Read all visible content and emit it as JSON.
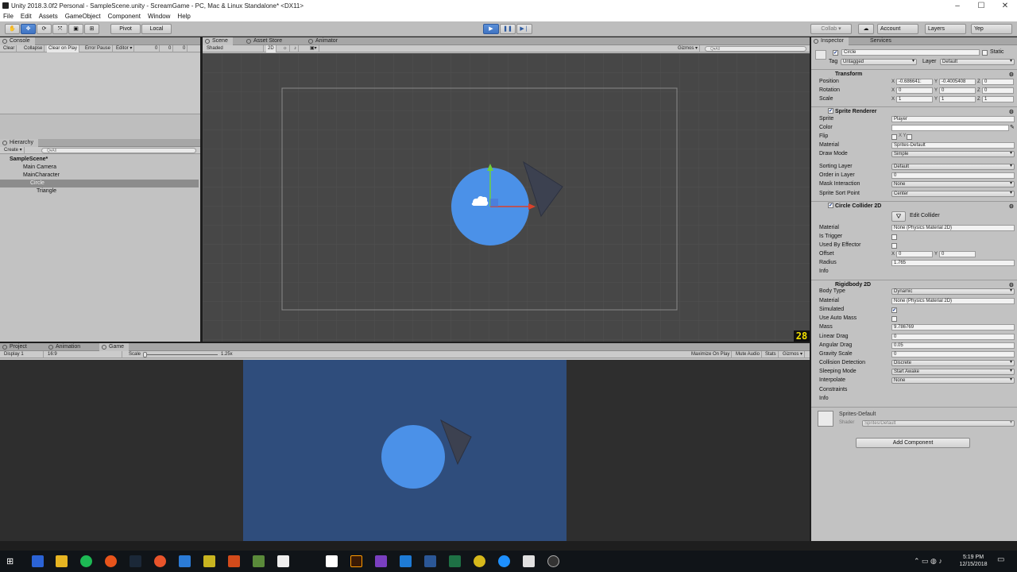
{
  "window": {
    "title": "Unity 2018.3.0f2 Personal - SampleScene.unity - ScreamGame - PC, Mac & Linux Standalone* <DX11>"
  },
  "menu": [
    "File",
    "Edit",
    "Assets",
    "GameObject",
    "Component",
    "Window",
    "Help"
  ],
  "toolbar": {
    "pivot": "Pivot",
    "local": "Local",
    "collab": "Collab ▾",
    "account": "Account",
    "layers": "Layers",
    "layout": "Yep"
  },
  "console": {
    "tab": "Console",
    "buttons": [
      "Clear",
      "Collapse",
      "Clear on Play",
      "Error Pause",
      "Editor ▾"
    ],
    "counts": [
      "0",
      "0",
      "0"
    ]
  },
  "hierarchy": {
    "tab": "Hierarchy",
    "create": "Create ▾",
    "search_placeholder": "Q▾All",
    "items": [
      {
        "label": "SampleScene*",
        "indent": 0
      },
      {
        "label": "Main Camera",
        "indent": 1
      },
      {
        "label": "MainCharacter",
        "indent": 1
      },
      {
        "label": "Circle",
        "indent": 2
      },
      {
        "label": "Triangle",
        "indent": 3
      }
    ]
  },
  "scene": {
    "tabs": [
      "Scene",
      "Asset Store",
      "Animator"
    ],
    "shading": "Shaded",
    "mode": "2D",
    "gizmos": "Gizmos ▾",
    "search_placeholder": "Q▾All",
    "fps": "28"
  },
  "game": {
    "tabs": [
      "Project",
      "Animation",
      "Game"
    ],
    "display": "Display 1",
    "aspect": "16:9",
    "scale_label": "Scale",
    "scale_value": "1.25x",
    "buttons": [
      "Maximize On Play",
      "Mute Audio",
      "Stats",
      "Gizmos ▾"
    ]
  },
  "inspector": {
    "tabs": [
      "Inspector",
      "Services"
    ],
    "object_name": "Circle",
    "static": "Static",
    "tag_label": "Tag",
    "tag": "Untagged",
    "layer_label": "Layer",
    "layer": "Default",
    "transform": {
      "title": "Transform",
      "position": {
        "label": "Position",
        "x": "-0.686641:",
        "y": "-0.4005408",
        "z": "0"
      },
      "rotation": {
        "label": "Rotation",
        "x": "0",
        "y": "0",
        "z": "0"
      },
      "scale": {
        "label": "Scale",
        "x": "1",
        "y": "1",
        "z": "1"
      }
    },
    "sprite_renderer": {
      "title": "Sprite Renderer",
      "rows": [
        {
          "label": "Sprite",
          "value": "Player",
          "kind": "field"
        },
        {
          "label": "Color",
          "value": "",
          "kind": "color"
        },
        {
          "label": "Flip",
          "value": "X  Y",
          "kind": "flip"
        },
        {
          "label": "Material",
          "value": "Sprites-Default",
          "kind": "field"
        },
        {
          "label": "Draw Mode",
          "value": "Simple",
          "kind": "dropdown"
        },
        {
          "label": "Sorting Layer",
          "value": "Default",
          "kind": "dropdown"
        },
        {
          "label": "Order in Layer",
          "value": "0",
          "kind": "field"
        },
        {
          "label": "Mask Interaction",
          "value": "None",
          "kind": "dropdown"
        },
        {
          "label": "Sprite Sort Point",
          "value": "Center",
          "kind": "dropdown"
        }
      ]
    },
    "circle_collider": {
      "title": "Circle Collider 2D",
      "edit": "Edit Collider",
      "material": {
        "label": "Material",
        "value": "None (Physics Material 2D)"
      },
      "is_trigger": "Is Trigger",
      "used_by_effector": "Used By Effector",
      "offset": {
        "label": "Offset",
        "x": "0",
        "y": "0"
      },
      "radius": {
        "label": "Radius",
        "value": "1.765"
      },
      "info": "Info"
    },
    "rigidbody": {
      "title": "Rigidbody 2D",
      "body_type": {
        "label": "Body Type",
        "value": "Dynamic"
      },
      "material": {
        "label": "Material",
        "value": "None (Physics Material 2D)"
      },
      "simulated": "Simulated",
      "use_auto_mass": "Use Auto Mass",
      "mass": {
        "label": "Mass",
        "value": "9.786769"
      },
      "linear_drag": {
        "label": "Linear Drag",
        "value": "0"
      },
      "angular_drag": {
        "label": "Angular Drag",
        "value": "0.05"
      },
      "gravity_scale": {
        "label": "Gravity Scale",
        "value": "0"
      },
      "collision": {
        "label": "Collision Detection",
        "value": "Discrete"
      },
      "sleeping": {
        "label": "Sleeping Mode",
        "value": "Start Awake"
      },
      "interpolate": {
        "label": "Interpolate",
        "value": "None"
      },
      "constraints": "Constraints",
      "info": "Info"
    },
    "material_asset": {
      "name": "Sprites-Default",
      "shader_label": "Shader",
      "shader": "Sprites/Default"
    },
    "add_component": "Add Component"
  },
  "taskbar": {
    "time": "5:19 PM",
    "date": "12/15/2018"
  },
  "colors": {
    "accent": "#3f73c2",
    "circle": "#4b91e8",
    "game_bg": "#2f4d7c",
    "scene_bg": "#474747",
    "triangle": "#3c4150"
  }
}
